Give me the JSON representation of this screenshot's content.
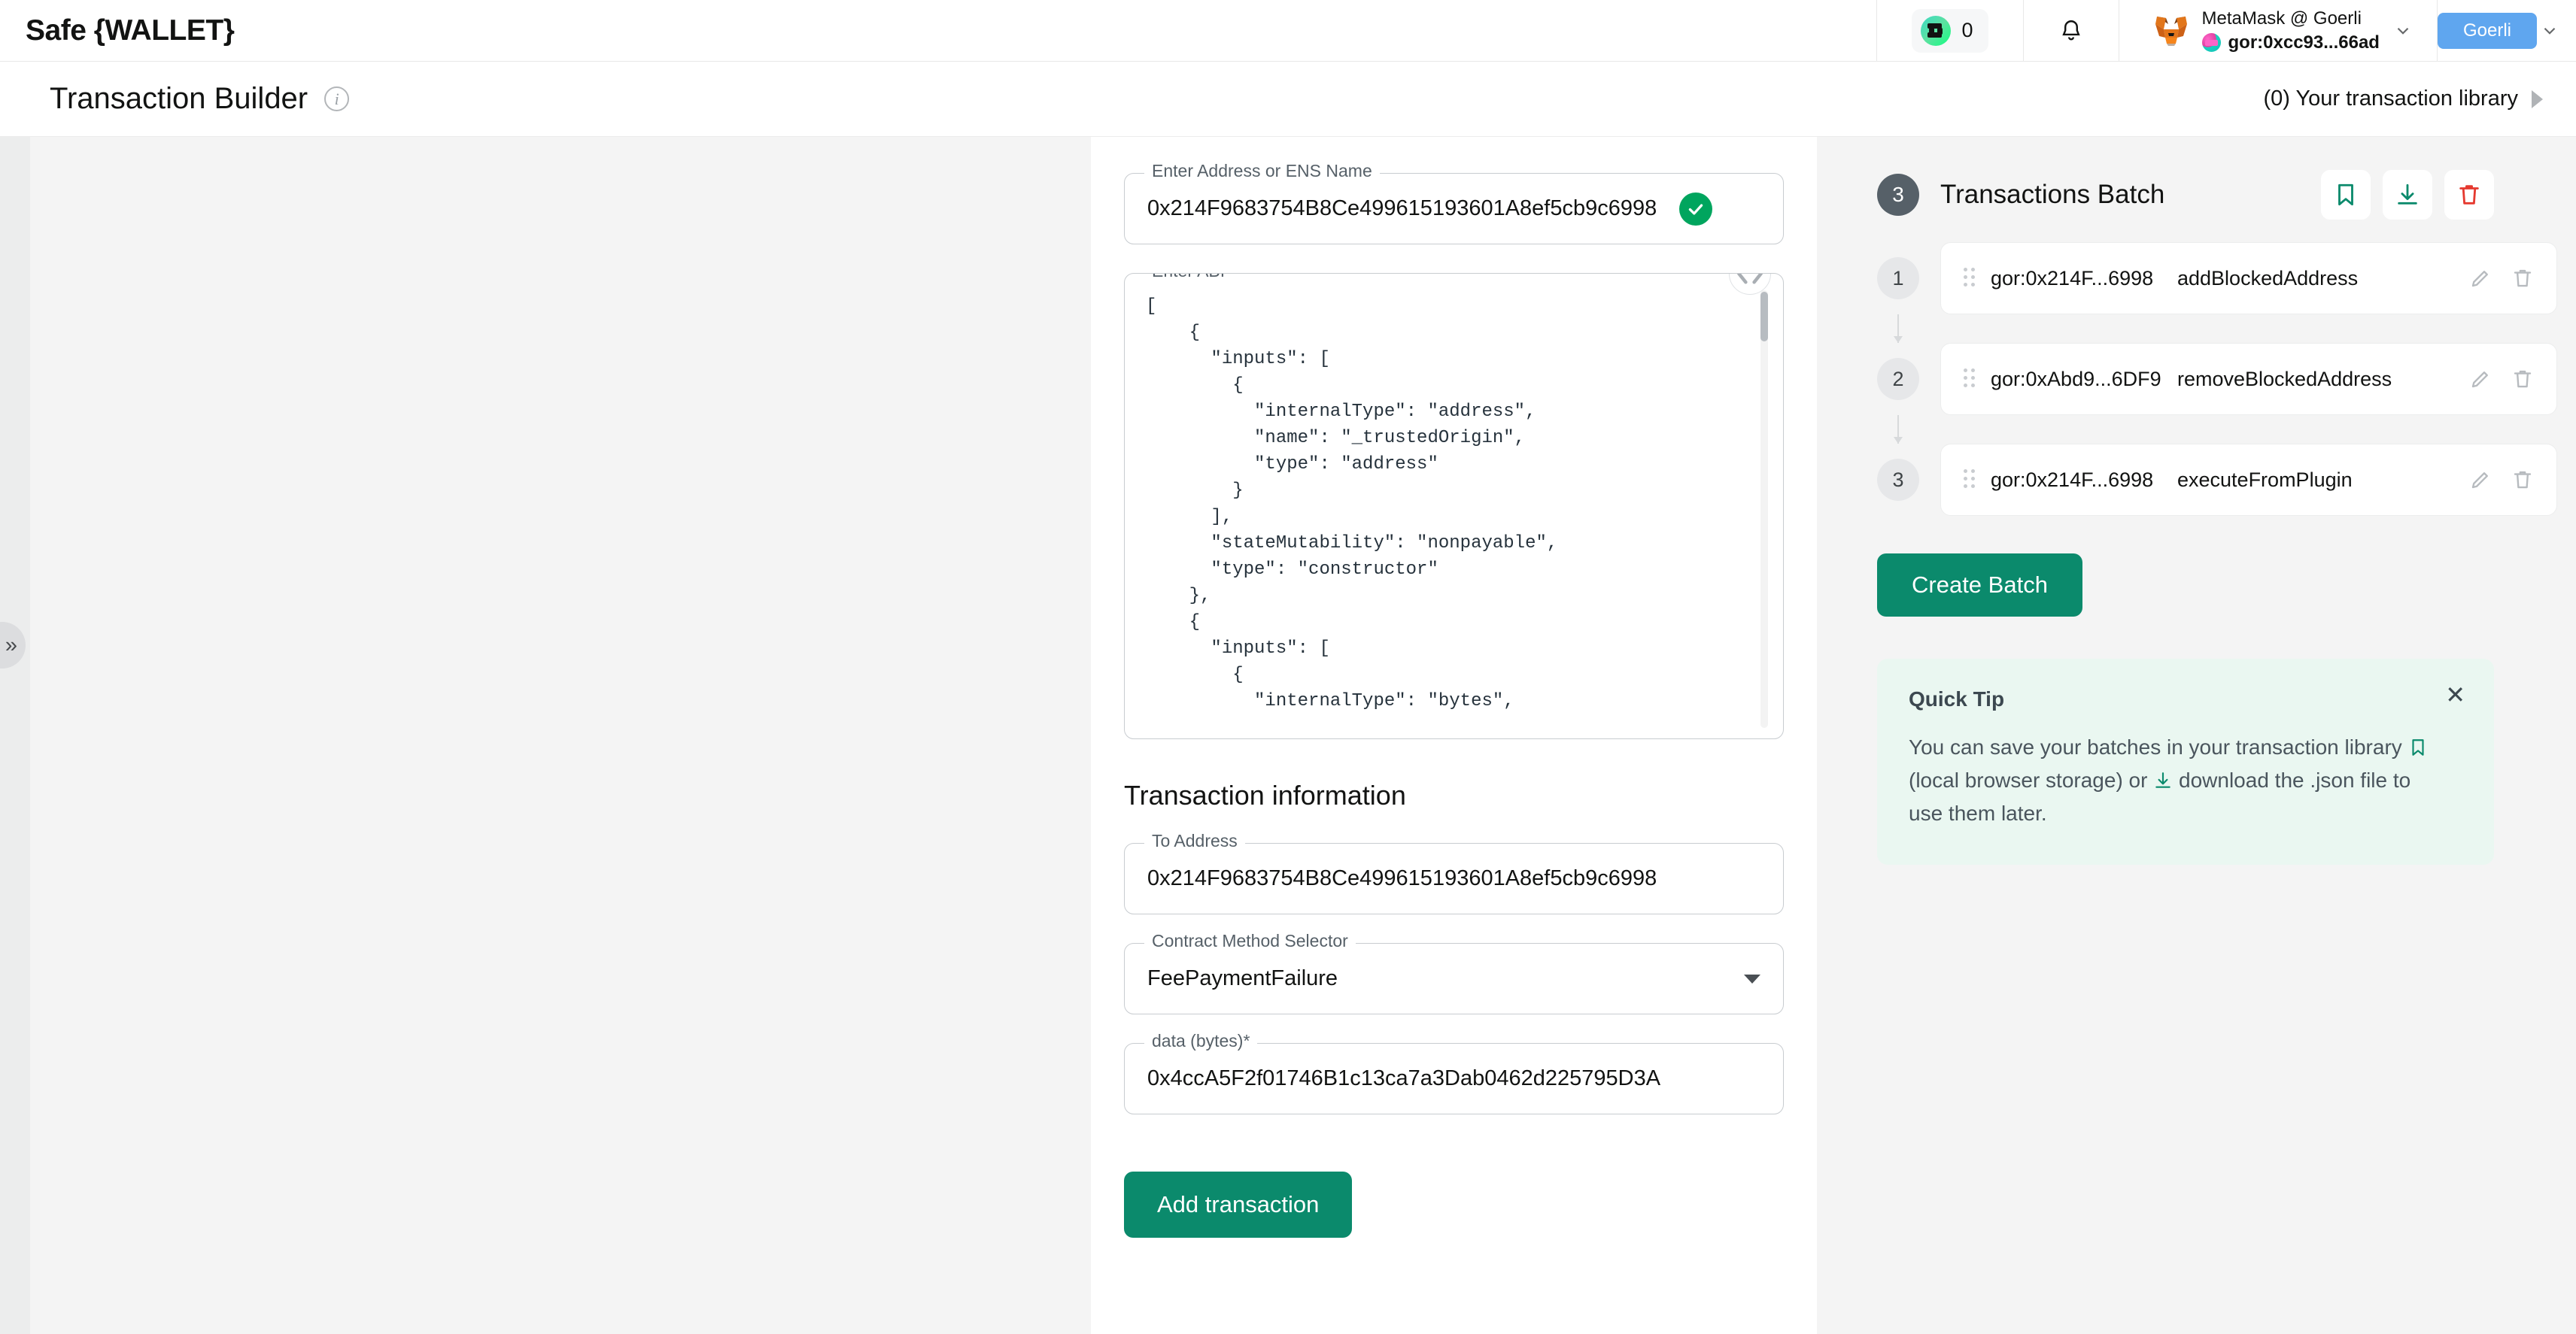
{
  "topbar": {
    "brand": "Safe {WALLET}",
    "tokens_count": "0",
    "safe_logo_icon": "safe-logo-icon",
    "bell_icon": "bell-icon",
    "account_name": "MetaMask @ Goerli",
    "account_address": "gor:0xcc93...66ad",
    "account_chevron_icon": "chevron-down-icon",
    "network_label": "Goerli",
    "network_chevron_icon": "chevron-down-icon"
  },
  "titlebar": {
    "page_title": "Transaction Builder",
    "info_icon": "info-icon",
    "info_glyph": "i",
    "library_label": "(0) Your transaction library",
    "library_chevron_icon": "chevron-right-icon"
  },
  "sidebar": {
    "collapse_glyph": "»"
  },
  "builder": {
    "address_field": {
      "label": "Enter Address or ENS Name",
      "value": "0x214F9683754B8Ce499615193601A8ef5cb9c6998",
      "valid_icon": "check-circle-icon"
    },
    "abi_field": {
      "label": "Enter ABI",
      "toggle_icon": "code-brackets-icon",
      "toggle_glyph": "‹›",
      "code": "[\n    {\n      \"inputs\": [\n        {\n          \"internalType\": \"address\",\n          \"name\": \"_trustedOrigin\",\n          \"type\": \"address\"\n        }\n      ],\n      \"stateMutability\": \"nonpayable\",\n      \"type\": \"constructor\"\n    },\n    {\n      \"inputs\": [\n        {\n          \"internalType\": \"bytes\","
    },
    "section_title": "Transaction information",
    "to_address_field": {
      "label": "To Address",
      "value": "0x214F9683754B8Ce499615193601A8ef5cb9c6998"
    },
    "method_selector_field": {
      "label": "Contract Method Selector",
      "value": "FeePaymentFailure",
      "caret_icon": "caret-down-icon"
    },
    "data_field": {
      "label": "data (bytes)*",
      "value": "0x4ccA5F2f01746B1c13ca7a3Dab0462d225795D3A"
    },
    "add_transaction_label": "Add transaction"
  },
  "batch": {
    "step_number": "3",
    "title": "Transactions Batch",
    "actions": [
      {
        "name": "save-to-library-button",
        "icon": "bookmark-icon"
      },
      {
        "name": "download-json-button",
        "icon": "download-icon"
      },
      {
        "name": "delete-batch-button",
        "icon": "trash-icon"
      }
    ],
    "transactions": [
      {
        "index": "1",
        "address": "gor:0x214F...6998",
        "method": "addBlockedAddress"
      },
      {
        "index": "2",
        "address": "gor:0xAbd9...6DF9",
        "method": "removeBlockedAddress"
      },
      {
        "index": "3",
        "address": "gor:0x214F...6998",
        "method": "executeFromPlugin"
      }
    ],
    "create_batch_label": "Create Batch",
    "row_edit_icon": "pencil-icon",
    "row_delete_icon": "trash-icon",
    "drag_handle_icon": "drag-handle-icon"
  },
  "quick_tip": {
    "title": "Quick Tip",
    "text_part1": "You can save your batches in your transaction library ",
    "text_part2": " (local browser storage) or ",
    "text_part3": " download the .json file to use them later.",
    "bookmark_icon": "bookmark-icon",
    "download_icon": "download-icon",
    "close_icon": "close-icon",
    "close_glyph": "✕"
  },
  "colors": {
    "brand_green": "#0b8a6c",
    "accent_blue": "#5fa6ef",
    "success_green": "#00a55e",
    "danger_red": "#e5392f",
    "tip_background": "#eaf7f1"
  }
}
